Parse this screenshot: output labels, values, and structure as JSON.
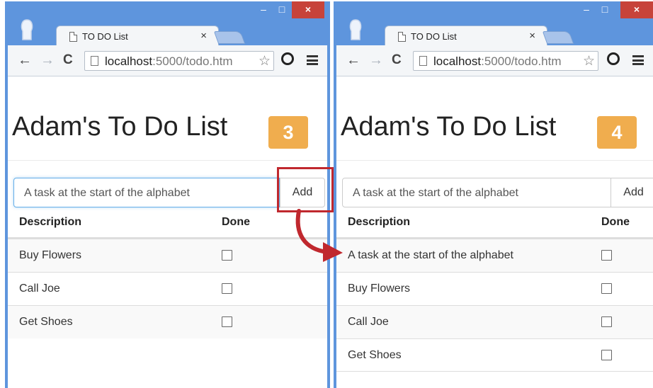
{
  "windows": [
    {
      "tab_title": "TO DO List",
      "tab_close": "×",
      "url_host": "localhost",
      "url_path": ":5000/todo.htm",
      "heading": "Adam's To Do List",
      "count": "3",
      "input_value": "A task at the start of the alphabet",
      "add_label": "Add",
      "col_description": "Description",
      "col_done": "Done",
      "rows": [
        {
          "description": "Buy Flowers",
          "done": false
        },
        {
          "description": "Call Joe",
          "done": false
        },
        {
          "description": "Get Shoes",
          "done": false
        }
      ]
    },
    {
      "tab_title": "TO DO List",
      "tab_close": "×",
      "url_host": "localhost",
      "url_path": ":5000/todo.htm",
      "heading": "Adam's To Do List",
      "count": "4",
      "input_value": "A task at the start of the alphabet",
      "add_label": "Add",
      "col_description": "Description",
      "col_done": "Done",
      "rows": [
        {
          "description": "A task at the start of the alphabet",
          "done": false
        },
        {
          "description": "Buy Flowers",
          "done": false
        },
        {
          "description": "Call Joe",
          "done": false
        },
        {
          "description": "Get Shoes",
          "done": false
        }
      ]
    }
  ],
  "window_controls": {
    "minimize": "–",
    "maximize": "□",
    "close": "×"
  },
  "icons": {
    "back": "back-arrow-icon",
    "forward": "forward-arrow-icon",
    "reload": "reload-icon",
    "page": "page-icon",
    "star": "star-icon",
    "extension": "extension-icon",
    "menu": "hamburger-menu-icon"
  },
  "colors": {
    "frame": "#5e95dd",
    "badge": "#f0ad4e",
    "highlight": "#c0282e"
  }
}
